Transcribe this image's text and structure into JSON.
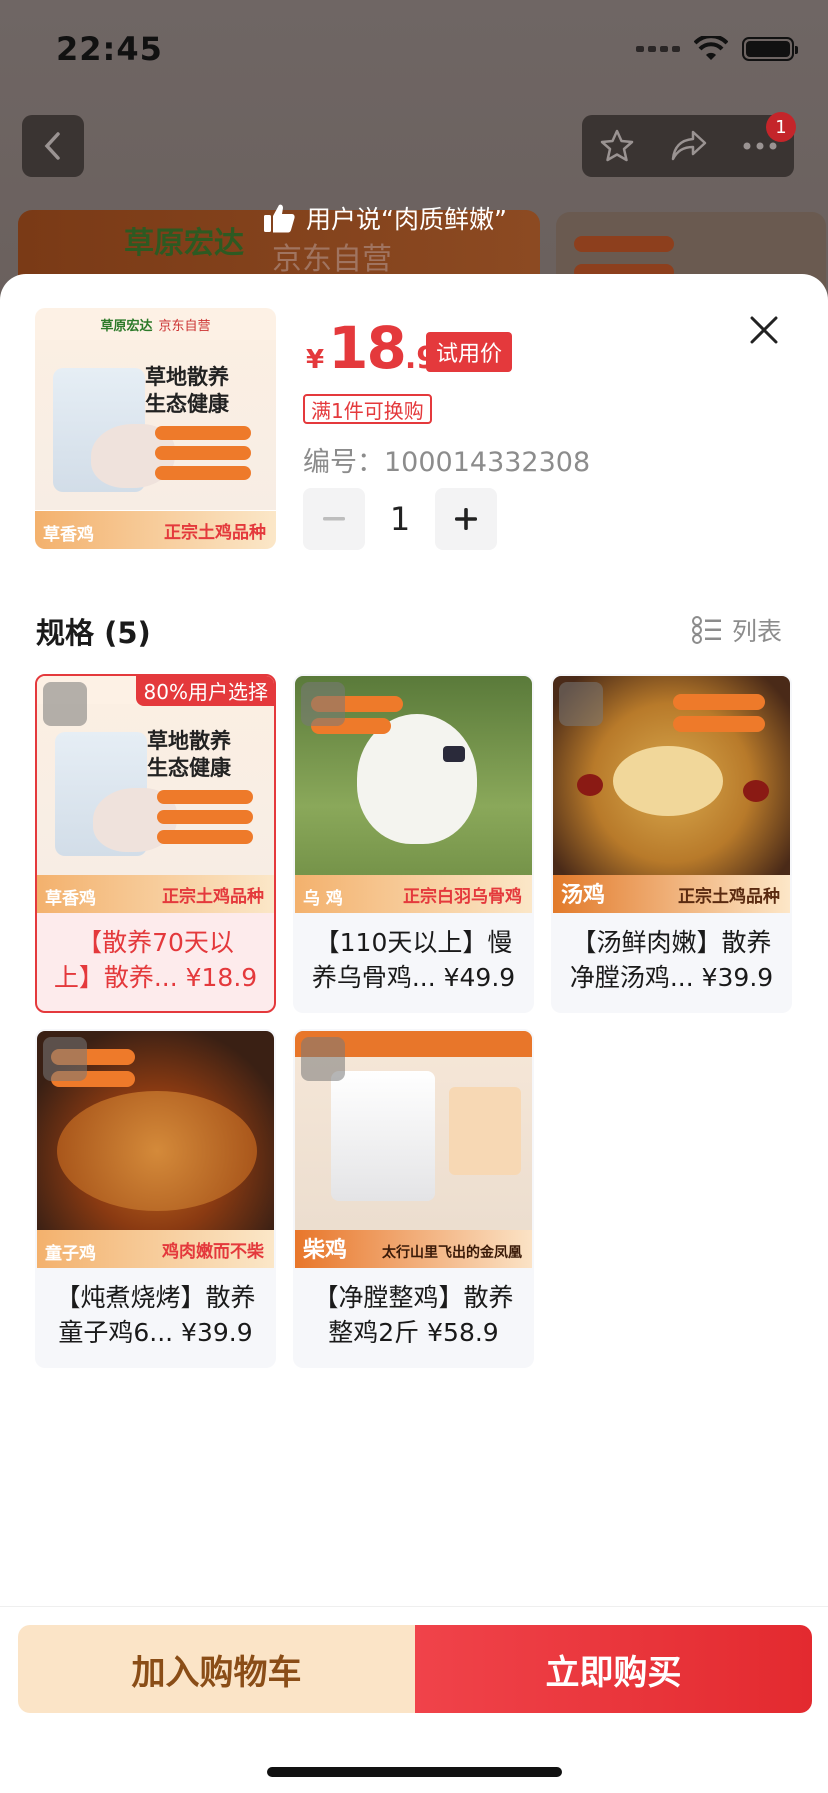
{
  "status_bar": {
    "time": "22:45"
  },
  "background": {
    "notification_count": "1",
    "banner_brand": "草原宏达",
    "banner_store": "京东自营",
    "user_says": "用户说“肉质鲜嫩”"
  },
  "product": {
    "price_symbol": "¥",
    "price_int": "18",
    "price_dec": ".9",
    "trial_label": "试用价",
    "promo_label": "满1件可换购",
    "sku_label": "编号：",
    "sku_value": "100014332308",
    "quantity": "1",
    "image": {
      "brand": "草原宏达",
      "store": "京东自营",
      "headline1": "草地散养",
      "headline2": "生态健康",
      "foot_left": "草香鸡",
      "foot_right": "正宗土鸡品种"
    }
  },
  "spec": {
    "title": "规格 (5)",
    "list_label": "列表",
    "popular_badge": "80%用户选择",
    "items": [
      {
        "line1": "【散养70天以",
        "line2": "上】散养... ¥18.9",
        "img_title": "草香鸡",
        "img_sub": "正宗土鸡品种",
        "headline1": "草地散养",
        "headline2": "生态健康",
        "selected": true
      },
      {
        "line1": "【110天以上】慢",
        "line2": "养乌骨鸡... ¥49.9",
        "img_title": "乌 鸡",
        "img_sub": "正宗白羽乌骨鸡"
      },
      {
        "line1": "【汤鲜肉嫩】散养",
        "line2": "净膛汤鸡... ¥39.9",
        "img_title": "汤鸡",
        "img_sub": "正宗土鸡品种"
      },
      {
        "line1": "【炖煮烧烤】散养",
        "line2": "童子鸡6... ¥39.9",
        "img_title": "童子鸡",
        "img_sub": "鸡肉嫩而不柴"
      },
      {
        "line1": "【净膛整鸡】散养",
        "line2": "整鸡2斤 ¥58.9",
        "img_title": "柴鸡",
        "img_sub": "太行山里飞出的金凤凰"
      }
    ]
  },
  "bottom": {
    "add_to_cart": "加入购物车",
    "buy_now": "立即购买"
  },
  "colors": {
    "accent_red": "#e4393c",
    "cart_bg": "#fbe4c7",
    "cart_text": "#8a4d17"
  }
}
